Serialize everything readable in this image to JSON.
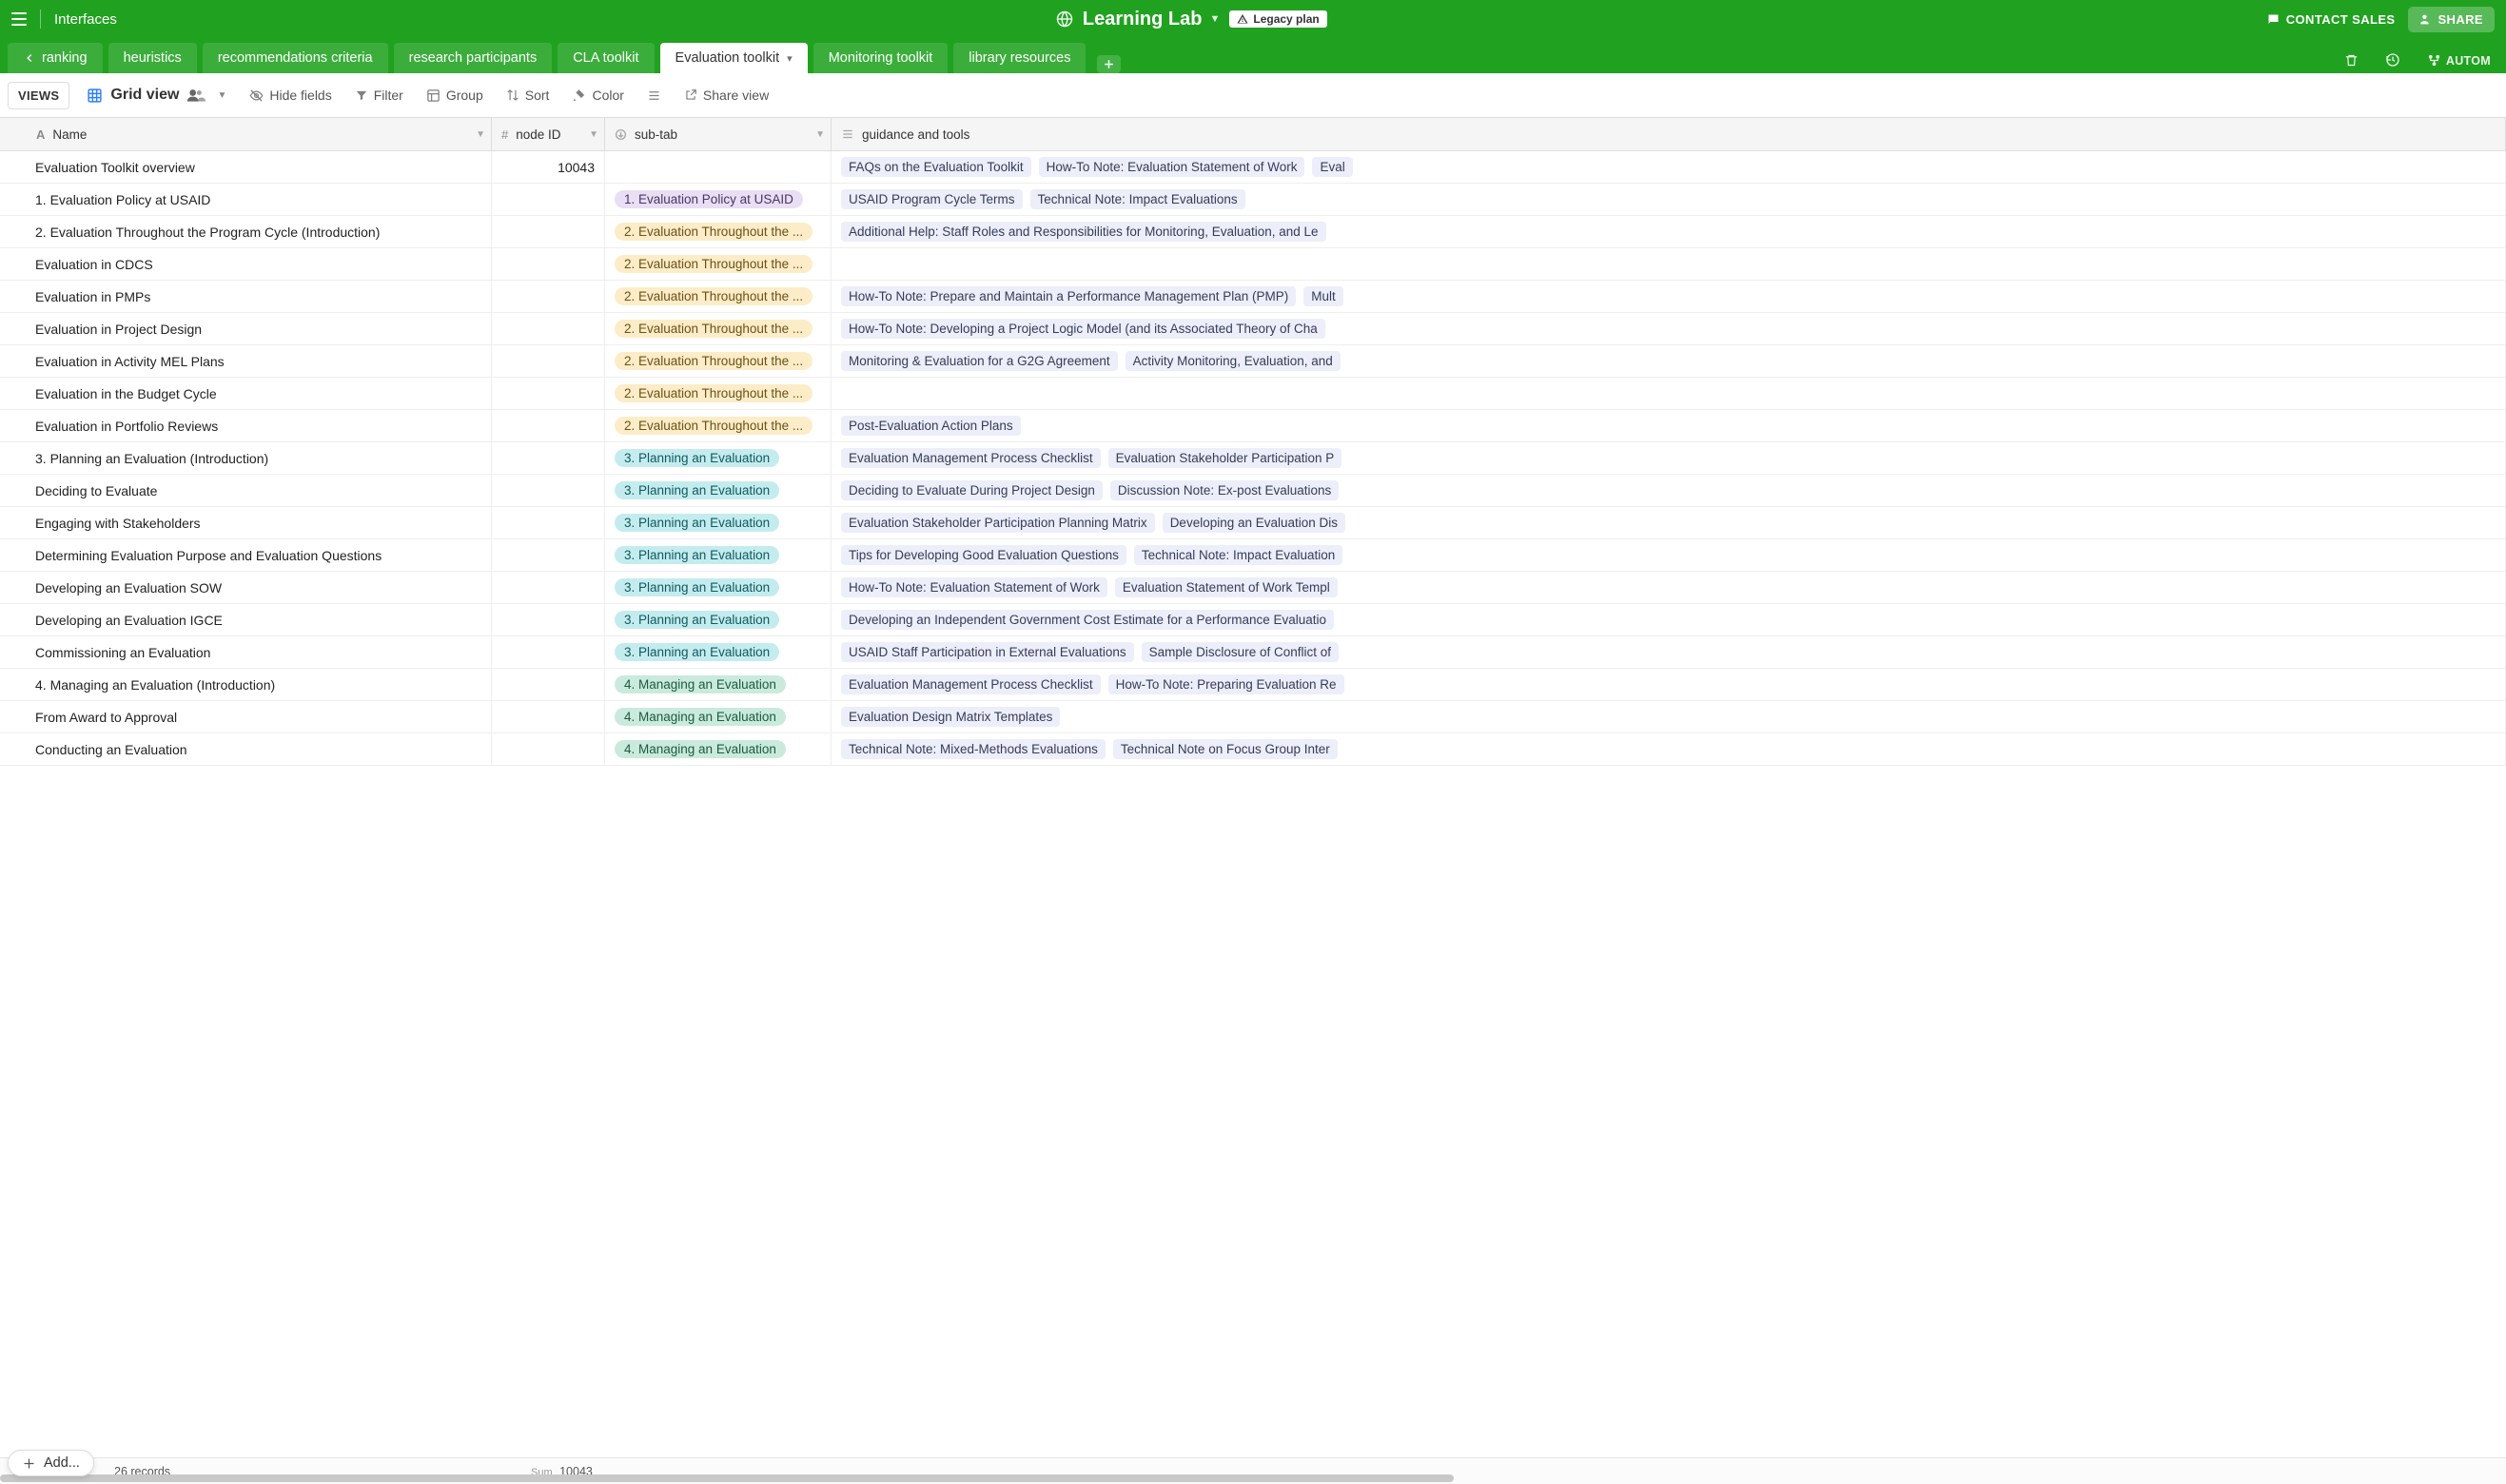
{
  "header": {
    "interfaces_label": "Interfaces",
    "base_name": "Learning Lab",
    "legacy_badge": "Legacy plan",
    "contact_label": "CONTACT SALES",
    "share_label": "SHARE"
  },
  "tabs": {
    "items": [
      {
        "label": "ranking",
        "active": false,
        "back": true
      },
      {
        "label": "heuristics",
        "active": false
      },
      {
        "label": "recommendations criteria",
        "active": false
      },
      {
        "label": "research participants",
        "active": false
      },
      {
        "label": "CLA toolkit",
        "active": false
      },
      {
        "label": "Evaluation toolkit",
        "active": true,
        "dropdown": true
      },
      {
        "label": "Monitoring toolkit",
        "active": false
      },
      {
        "label": "library resources",
        "active": false
      }
    ],
    "automations_label": "AUTOM"
  },
  "viewbar": {
    "views_label": "VIEWS",
    "gridview_label": "Grid view",
    "hide_fields": "Hide fields",
    "filter": "Filter",
    "group": "Group",
    "sort": "Sort",
    "color": "Color",
    "share_view": "Share view"
  },
  "columns": [
    {
      "label": "Name",
      "type": "text"
    },
    {
      "label": "node ID",
      "type": "number"
    },
    {
      "label": "sub-tab",
      "type": "select"
    },
    {
      "label": "guidance and tools",
      "type": "multiselect"
    }
  ],
  "subtab_colors": {
    "1. Evaluation Policy at USAID": "pill-purple",
    "2. Evaluation Throughout the ...": "pill-yellow",
    "3. Planning an Evaluation": "pill-cyan",
    "4. Managing an Evaluation": "pill-green"
  },
  "rows": [
    {
      "name": "Evaluation Toolkit overview",
      "node_id": "10043",
      "subtab": "",
      "tags": [
        "FAQs on the Evaluation Toolkit",
        "How-To Note: Evaluation Statement of Work",
        "Eval"
      ]
    },
    {
      "name": "1. Evaluation Policy at USAID",
      "node_id": "",
      "subtab": "1. Evaluation Policy at USAID",
      "tags": [
        "USAID Program Cycle Terms",
        "Technical Note: Impact Evaluations"
      ]
    },
    {
      "name": "2. Evaluation Throughout the Program Cycle (Introduction)",
      "node_id": "",
      "subtab": "2. Evaluation Throughout the ...",
      "tags": [
        "Additional Help: Staff Roles and Responsibilities for Monitoring, Evaluation, and Le"
      ]
    },
    {
      "name": "Evaluation in CDCS",
      "node_id": "",
      "subtab": "2. Evaluation Throughout the ...",
      "tags": []
    },
    {
      "name": "Evaluation in PMPs",
      "node_id": "",
      "subtab": "2. Evaluation Throughout the ...",
      "tags": [
        "How-To Note: Prepare and Maintain a Performance Management Plan (PMP)",
        "Mult"
      ]
    },
    {
      "name": "Evaluation in Project Design",
      "node_id": "",
      "subtab": "2. Evaluation Throughout the ...",
      "tags": [
        "How-To Note: Developing a Project Logic Model (and its Associated Theory of Cha"
      ]
    },
    {
      "name": "Evaluation in Activity MEL Plans",
      "node_id": "",
      "subtab": "2. Evaluation Throughout the ...",
      "tags": [
        "Monitoring & Evaluation for a G2G Agreement",
        "Activity Monitoring, Evaluation, and"
      ]
    },
    {
      "name": "Evaluation in the Budget Cycle",
      "node_id": "",
      "subtab": "2. Evaluation Throughout the ...",
      "tags": []
    },
    {
      "name": "Evaluation in Portfolio Reviews",
      "node_id": "",
      "subtab": "2. Evaluation Throughout the ...",
      "tags": [
        "Post-Evaluation Action Plans"
      ]
    },
    {
      "name": "3. Planning an Evaluation (Introduction)",
      "node_id": "",
      "subtab": "3. Planning an Evaluation",
      "tags": [
        "Evaluation Management Process Checklist",
        "Evaluation Stakeholder Participation P"
      ]
    },
    {
      "name": "Deciding to Evaluate",
      "node_id": "",
      "subtab": "3. Planning an Evaluation",
      "tags": [
        "Deciding to Evaluate During Project Design",
        "Discussion Note: Ex-post Evaluations"
      ]
    },
    {
      "name": "Engaging with Stakeholders",
      "node_id": "",
      "subtab": "3. Planning an Evaluation",
      "tags": [
        "Evaluation Stakeholder Participation Planning Matrix",
        "Developing an Evaluation Dis"
      ]
    },
    {
      "name": "Determining Evaluation Purpose and Evaluation Questions",
      "node_id": "",
      "subtab": "3. Planning an Evaluation",
      "tags": [
        "Tips for Developing Good Evaluation Questions",
        "Technical Note: Impact Evaluation"
      ]
    },
    {
      "name": "Developing an Evaluation SOW",
      "node_id": "",
      "subtab": "3. Planning an Evaluation",
      "tags": [
        "How-To Note: Evaluation Statement of Work",
        "Evaluation Statement of Work Templ"
      ]
    },
    {
      "name": "Developing an Evaluation IGCE",
      "node_id": "",
      "subtab": "3. Planning an Evaluation",
      "tags": [
        "Developing an Independent Government Cost Estimate for a Performance Evaluatio"
      ]
    },
    {
      "name": "Commissioning an Evaluation",
      "node_id": "",
      "subtab": "3. Planning an Evaluation",
      "tags": [
        "USAID Staff Participation in External Evaluations",
        "Sample Disclosure of Conflict of"
      ]
    },
    {
      "name": "4. Managing an Evaluation (Introduction)",
      "node_id": "",
      "subtab": "4. Managing an Evaluation",
      "tags": [
        "Evaluation Management Process Checklist",
        "How-To Note: Preparing Evaluation Re"
      ]
    },
    {
      "name": "From Award to Approval",
      "node_id": "",
      "subtab": "4. Managing an Evaluation",
      "tags": [
        "Evaluation Design Matrix Templates"
      ]
    },
    {
      "name": "Conducting an Evaluation",
      "node_id": "",
      "subtab": "4. Managing an Evaluation",
      "tags": [
        "Technical Note: Mixed-Methods Evaluations",
        "Technical Note on Focus Group Inter"
      ]
    }
  ],
  "footer": {
    "add_label": "Add...",
    "record_count": "26 records",
    "sum_label": "Sum",
    "sum_value": "10043"
  }
}
